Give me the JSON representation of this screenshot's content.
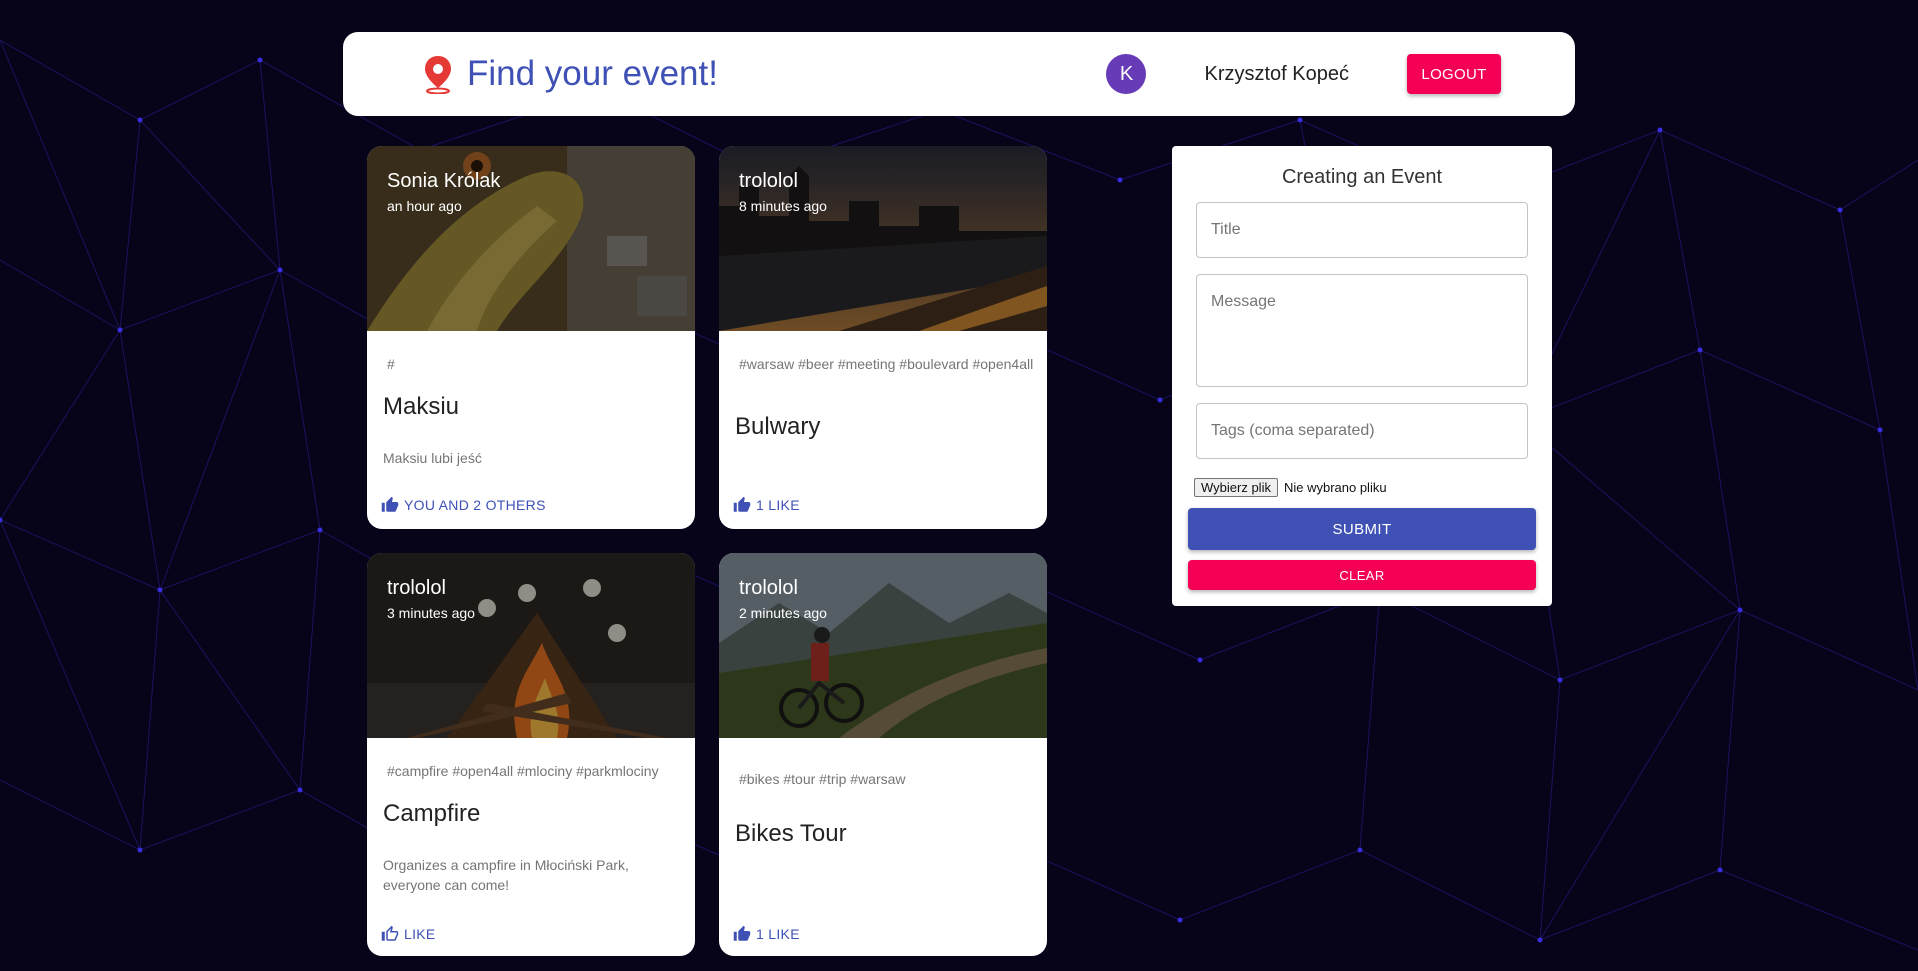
{
  "header": {
    "title": "Find your event!",
    "user_initial": "K",
    "user_name": "Krzysztof Kopeć",
    "logout_label": "LOGOUT"
  },
  "posts": [
    {
      "author": "Sonia Królak",
      "time": "an hour ago",
      "tags": "#",
      "title": "Maksiu",
      "message": "Maksiu lubi jeść",
      "likes_label": "YOU AND 2 OTHERS",
      "image": "lizard-photo"
    },
    {
      "author": "trololol",
      "time": "8 minutes ago",
      "tags": "#warsaw #beer #meeting #boulevard #open4all",
      "title": "Bulwary",
      "message": "",
      "likes_label": "1 LIKE",
      "image": "city-river-night-photo"
    },
    {
      "author": "trololol",
      "time": "3 minutes ago",
      "tags": "#campfire #open4all #mlociny #parkmlociny",
      "title": "Campfire",
      "message": "Organizes a campfire in Młociński Park, everyone can come!",
      "likes_label": "LIKE",
      "image": "campfire-photo"
    },
    {
      "author": "trololol",
      "time": "2 minutes ago",
      "tags": "#bikes #tour #trip #warsaw",
      "title": "Bikes Tour",
      "message": "",
      "likes_label": "1 LIKE",
      "image": "mountain-bike-photo"
    }
  ],
  "form": {
    "heading": "Creating an Event",
    "title_placeholder": "Title",
    "message_placeholder": "Message",
    "tags_placeholder": "Tags (coma separated)",
    "file_button": "Wybierz plik",
    "file_status": "Nie wybrano pliku",
    "submit_label": "SUBMIT",
    "clear_label": "CLEAR"
  },
  "colors": {
    "primary": "#3f51b5",
    "secondary": "#f50057",
    "avatar": "#673ab7",
    "background": "#07041a",
    "network_lines": "#2a1fa0"
  }
}
